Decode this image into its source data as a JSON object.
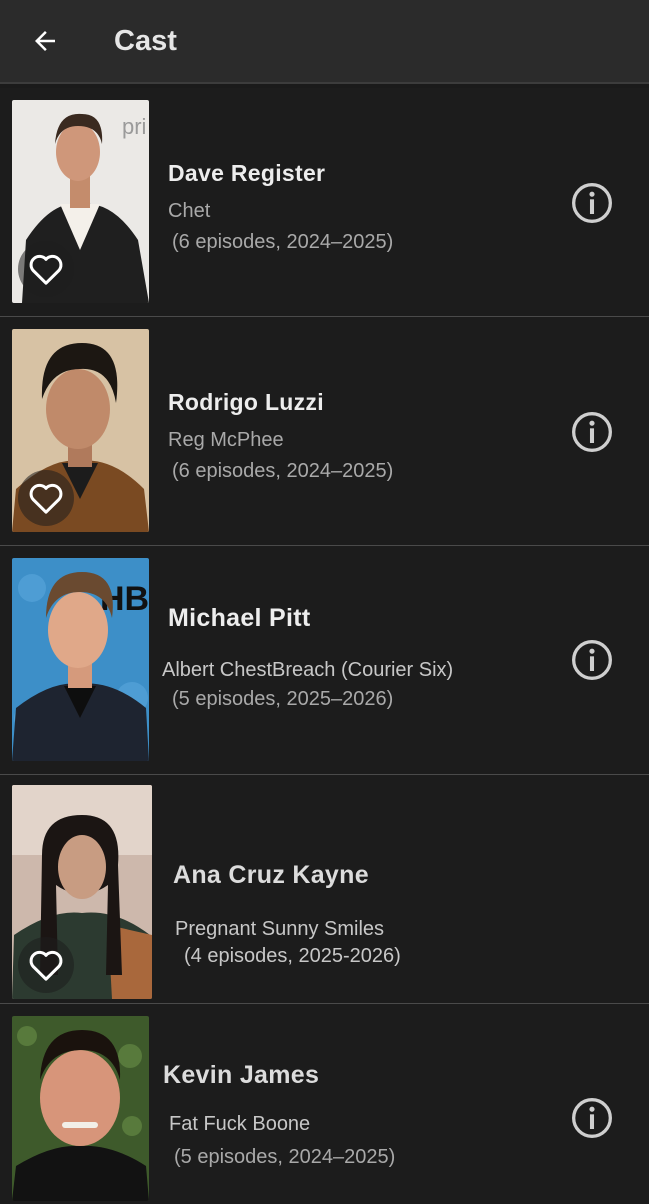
{
  "header": {
    "title": "Cast",
    "back_icon": "arrow-left-icon"
  },
  "cast": [
    {
      "name": "Dave Register",
      "role": "Chet",
      "episodes": "(6 episodes, 2024–2025)",
      "favorite": true,
      "photo_bg": "#e9e7e4",
      "photo_text": "pri"
    },
    {
      "name": "Rodrigo Luzzi",
      "role": "Reg McPhee",
      "episodes": "(6 episodes, 2024–2025)",
      "favorite": true,
      "photo_bg": "#d8c3a7"
    },
    {
      "name": "Michael Pitt",
      "role": "Albert ChestBreach (Courier Six)",
      "episodes": "(5 episodes, 2025–2026)",
      "favorite": false,
      "photo_bg": "#3d8fc8",
      "photo_text": "HBO"
    },
    {
      "name": "Ana Cruz Kayne",
      "role": "Pregnant Sunny Smiles",
      "episodes": "(4 episodes, 2025-2026)",
      "favorite": true,
      "photo_bg": "#c9b8ae"
    },
    {
      "name": "Kevin James",
      "role": "Fat Fuck Boone",
      "episodes": "(5 episodes, 2024–2025)",
      "favorite": false,
      "photo_bg": "#3f5a2c"
    }
  ],
  "colors": {
    "background": "#1a1a1a",
    "appbar": "#2b2b2b",
    "text": "#ededed",
    "secondary": "#a9a9a9",
    "icon": "#cfcfcf"
  }
}
